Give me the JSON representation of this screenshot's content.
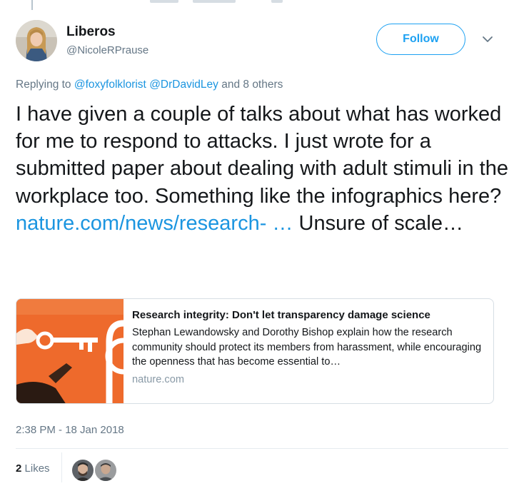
{
  "author": {
    "name": "Liberos",
    "handle": "@NicoleRPrause"
  },
  "follow_label": "Follow",
  "reply_context": {
    "prefix": "Replying to",
    "mention1": "@foxyfolklorist",
    "mention2": "@DrDavidLey",
    "suffix": "and 8 others"
  },
  "tweet": {
    "text": "I have given a couple of talks about what has worked for me to respond to attacks. I just wrote for a submitted paper about dealing with adult stimuli in the workplace too. Something like the infographics here?",
    "link": "nature.com/news/research-  …",
    "text_after": " Unsure of scale…"
  },
  "card": {
    "title": "Research integrity: Don't let transparency damage science",
    "description": "Stephan Lewandowsky and Dorothy Bishop explain how the research community should protect its members from harassment, while encouraging the openness that has become essential to…",
    "domain": "nature.com"
  },
  "timestamp": "2:38 PM - 18 Jan 2018",
  "likes": {
    "count": "2",
    "label": "Likes"
  },
  "colors": {
    "accent": "#1da1f2",
    "link": "#1b95e0",
    "muted": "#657786",
    "card_image_orange": "#ee6a2c"
  },
  "icons": [
    "caret-down-icon"
  ]
}
